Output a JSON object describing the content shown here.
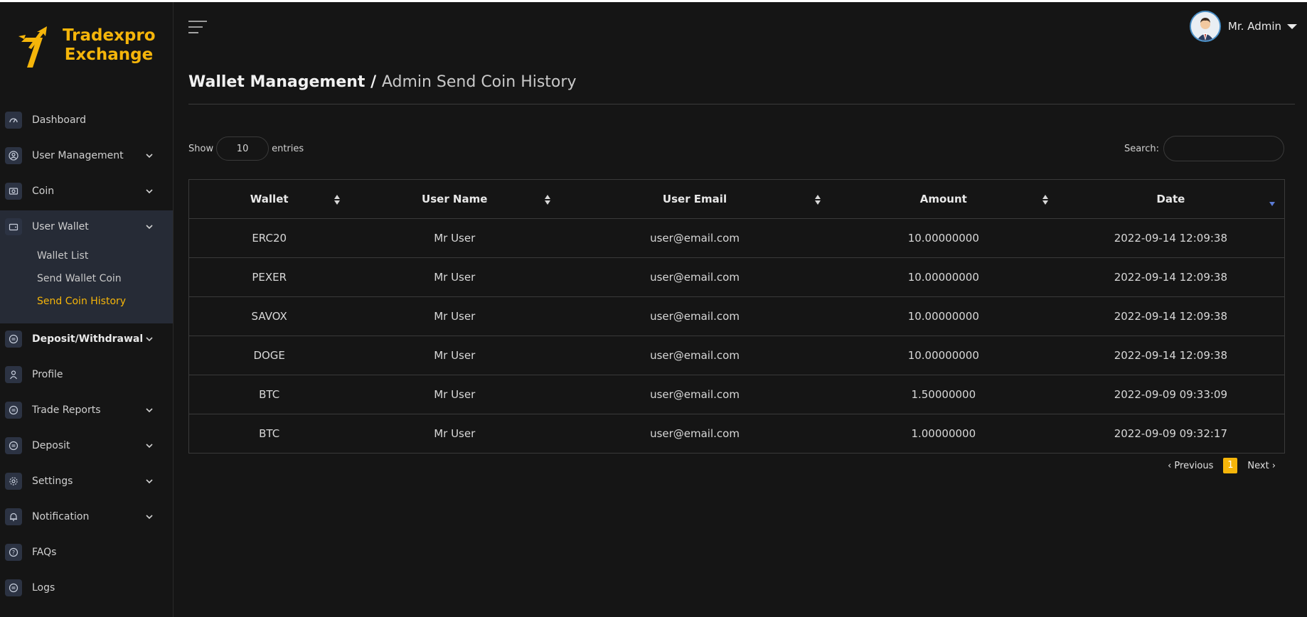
{
  "brand": {
    "line1": "Tradexpro",
    "line2": "Exchange",
    "color": "#f5b50a"
  },
  "header": {
    "user_name": "Mr. Admin"
  },
  "sidebar": {
    "items": [
      {
        "label": "Dashboard",
        "icon": "dashboard-icon"
      },
      {
        "label": "User Management",
        "icon": "user-circle-icon"
      },
      {
        "label": "Coin",
        "icon": "coin-icon"
      },
      {
        "label": "User Wallet",
        "icon": "wallet-icon"
      },
      {
        "label": "Deposit/Withdrawal",
        "icon": "exchange-icon"
      },
      {
        "label": "Profile",
        "icon": "user-icon"
      },
      {
        "label": "Trade Reports",
        "icon": "exchange-icon"
      },
      {
        "label": "Deposit",
        "icon": "exchange-icon"
      },
      {
        "label": "Settings",
        "icon": "gear-icon"
      },
      {
        "label": "Notification",
        "icon": "bell-icon"
      },
      {
        "label": "FAQs",
        "icon": "question-icon"
      },
      {
        "label": "Logs",
        "icon": "exchange-icon"
      }
    ],
    "wallet_sub": [
      "Wallet List",
      "Send Wallet Coin",
      "Send Coin History"
    ]
  },
  "page": {
    "title": "Wallet Management /",
    "crumb": "Admin Send Coin History"
  },
  "table_controls": {
    "show_label": "Show",
    "entries_value": "10",
    "entries_label": "entries",
    "search_label": "Search:"
  },
  "table": {
    "headers": [
      "Wallet",
      "User Name",
      "User Email",
      "Amount",
      "Date"
    ],
    "rows": [
      [
        "ERC20",
        "Mr User",
        "user@email.com",
        "10.00000000",
        "2022-09-14 12:09:38"
      ],
      [
        "PEXER",
        "Mr User",
        "user@email.com",
        "10.00000000",
        "2022-09-14 12:09:38"
      ],
      [
        "SAVOX",
        "Mr User",
        "user@email.com",
        "10.00000000",
        "2022-09-14 12:09:38"
      ],
      [
        "DOGE",
        "Mr User",
        "user@email.com",
        "10.00000000",
        "2022-09-14 12:09:38"
      ],
      [
        "BTC",
        "Mr User",
        "user@email.com",
        "1.50000000",
        "2022-09-09 09:33:09"
      ],
      [
        "BTC",
        "Mr User",
        "user@email.com",
        "1.00000000",
        "2022-09-09 09:32:17"
      ]
    ]
  },
  "pagination": {
    "previous": "‹ Previous",
    "current": "1",
    "next": "Next ›"
  }
}
